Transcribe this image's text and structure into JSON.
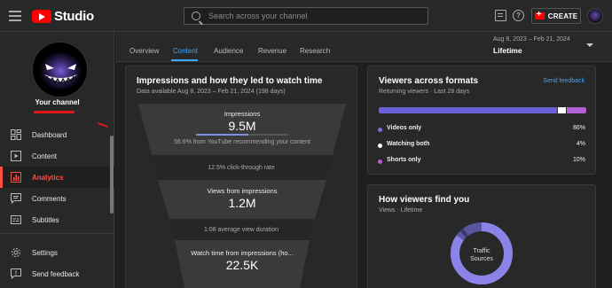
{
  "header": {
    "logo_text": "Studio",
    "search_placeholder": "Search across your channel",
    "create_label": "CREATE"
  },
  "sidebar": {
    "channel_name": "Your channel",
    "items": [
      {
        "label": "Dashboard",
        "icon": "dashboard-icon",
        "active": false
      },
      {
        "label": "Content",
        "icon": "content-icon",
        "active": false
      },
      {
        "label": "Analytics",
        "icon": "analytics-icon",
        "active": true
      },
      {
        "label": "Comments",
        "icon": "comments-icon",
        "active": false
      },
      {
        "label": "Subtitles",
        "icon": "subtitles-icon",
        "active": false
      },
      {
        "label": "Settings",
        "icon": "gear-icon",
        "active": false
      },
      {
        "label": "Send feedback",
        "icon": "feedback-icon",
        "active": false
      }
    ]
  },
  "tabs": {
    "items": [
      "Overview",
      "Content",
      "Audience",
      "Revenue",
      "Research"
    ],
    "active": "Content"
  },
  "date": {
    "range": "Aug 8, 2023 – Feb 21, 2024",
    "period": "Lifetime"
  },
  "impressions_card": {
    "title": "Impressions and how they led to watch time",
    "subtitle": "Data available Aug 8, 2023 – Feb 21, 2024 (198 days)",
    "impressions_label": "Impressions",
    "impressions_value": "9.5M",
    "impressions_progress": 0.566,
    "impressions_note": "56.6% from YouTube recommending your content",
    "ctr_note": "12.5% click-through rate",
    "views_label": "Views from impressions",
    "views_value": "1.2M",
    "avd_note": "1:08 average view duration",
    "watch_label": "Watch time from impressions (ho...",
    "watch_value": "22.5K"
  },
  "formats_card": {
    "title": "Viewers across formats",
    "subtitle": "Returning viewers · Last 28 days",
    "feedback_label": "Send feedback",
    "rows": [
      {
        "label": "Videos only",
        "pct": "86%",
        "color": "#7b6fe0",
        "value": 86
      },
      {
        "label": "Watching both",
        "pct": "4%",
        "color": "#ffffff",
        "value": 4
      },
      {
        "label": "Shorts only",
        "pct": "10%",
        "color": "#b160d6",
        "value": 10
      }
    ]
  },
  "find_card": {
    "title": "How viewers find you",
    "subtitle": "Views · Lifetime",
    "donut_label_1": "Traffic",
    "donut_label_2": "Sources"
  },
  "colors": {
    "accent_red": "#ff0000",
    "tab_blue": "#3ea6ff",
    "bar_purple": "#6a60d8",
    "donut_purple": "#8b83e8"
  }
}
